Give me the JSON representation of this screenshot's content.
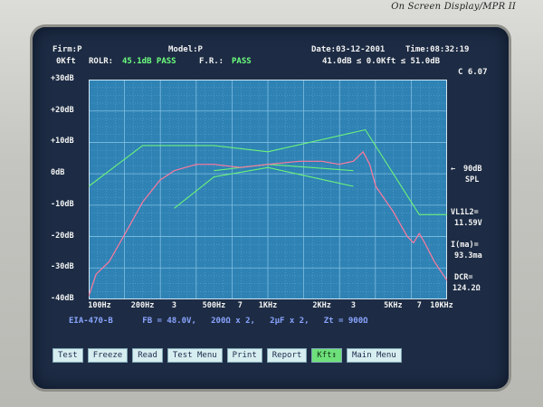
{
  "brand": "On Screen Display/MPR II",
  "header": {
    "line1": {
      "firm": "Firm:P",
      "model": "Model:P",
      "date": "Date:03-12-2001",
      "time": "Time:08:32:19"
    },
    "line2": {
      "kft": "0Kft",
      "rolr_label": "ROLR:",
      "rolr_value": "45.1dB PASS",
      "fr_label": "F.R.:",
      "fr_value": "PASS",
      "range": "41.0dB ≤  0.0Kft ≤  51.0dB",
      "version": "C 6.07"
    }
  },
  "y_tick_labels": [
    "+30dB",
    "+20dB",
    "+10dB",
    "0dB",
    "-10dB",
    "-20dB",
    "-30dB",
    "-40dB"
  ],
  "x_tick_labels": [
    "100Hz",
    "200Hz",
    "3",
    "500Hz",
    "7",
    "1KHz",
    "2KHz",
    "3",
    "5KHz",
    "7",
    "10KHz"
  ],
  "right_panel": {
    "spl_value": "90dB",
    "spl_label": "SPL",
    "vl_label": "VL1L2=",
    "vl_value": "11.59V",
    "ima_label": "I(ma)=",
    "ima_value": "93.3ma",
    "dcr_label": "DCR=",
    "dcr_value": "124.2Ω"
  },
  "info_line": "EIA-470-B      FB = 48.0V,   200Ω x 2,   2μF x 2,   Zt = 900Ω",
  "buttons": [
    {
      "label": "Test",
      "active": false
    },
    {
      "label": "Freeze",
      "active": false
    },
    {
      "label": "Read",
      "active": false
    },
    {
      "label": "Test Menu",
      "active": false
    },
    {
      "label": "Print",
      "active": false
    },
    {
      "label": "Report",
      "active": false
    },
    {
      "label": "Kft↕",
      "active": true
    },
    {
      "label": "Main Menu",
      "active": false
    }
  ],
  "colors": {
    "plot_bg": "#2f82b4",
    "grid": "#7fbfe2",
    "mask": "#6cf27a",
    "response": "#ff7a9c",
    "button_bg": "#d7eef0",
    "button_active": "#6ee07a"
  },
  "chart_data": {
    "type": "line",
    "x_scale": "log",
    "xlim": [
      100,
      10000
    ],
    "ylim": [
      -40,
      30
    ],
    "grid": true,
    "series": [
      {
        "role": "upper-mask",
        "points": [
          [
            100,
            -4
          ],
          [
            200,
            9
          ],
          [
            500,
            9
          ],
          [
            1000,
            7
          ],
          [
            3500,
            14
          ],
          [
            7000,
            -13
          ],
          [
            10000,
            -13
          ]
        ]
      },
      {
        "role": "lower-mask",
        "points": [
          [
            300,
            -11
          ],
          [
            500,
            -1
          ],
          [
            1000,
            2
          ],
          [
            3000,
            -4
          ]
        ]
      },
      {
        "role": "mid-mask",
        "points": [
          [
            500,
            1
          ],
          [
            1000,
            3
          ],
          [
            3000,
            1
          ]
        ]
      },
      {
        "role": "response",
        "points": [
          [
            100,
            -39
          ],
          [
            110,
            -32
          ],
          [
            130,
            -28
          ],
          [
            160,
            -19
          ],
          [
            200,
            -9
          ],
          [
            250,
            -2
          ],
          [
            300,
            1
          ],
          [
            400,
            3
          ],
          [
            500,
            3
          ],
          [
            700,
            2
          ],
          [
            1000,
            3
          ],
          [
            1500,
            4
          ],
          [
            2000,
            4
          ],
          [
            2500,
            3
          ],
          [
            3000,
            4
          ],
          [
            3400,
            7
          ],
          [
            3700,
            3
          ],
          [
            4000,
            -4
          ],
          [
            5000,
            -12
          ],
          [
            6000,
            -20
          ],
          [
            6500,
            -22
          ],
          [
            7000,
            -19
          ],
          [
            7500,
            -22
          ],
          [
            8500,
            -28
          ],
          [
            10000,
            -34
          ]
        ]
      }
    ]
  }
}
